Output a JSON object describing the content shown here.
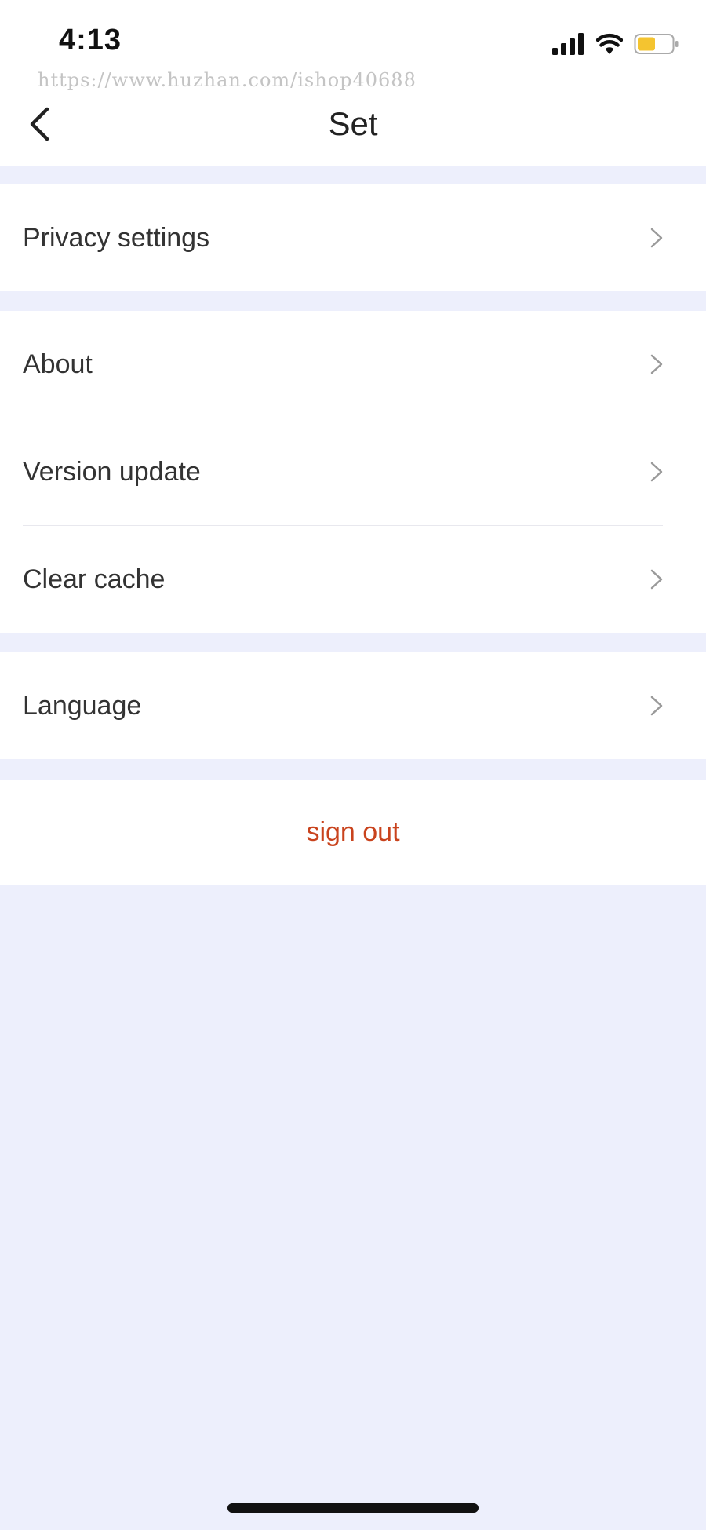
{
  "status_bar": {
    "time": "4:13",
    "battery_color": "#F4C430"
  },
  "watermark": "https://www.huzhan.com/ishop40688",
  "header": {
    "title": "Set"
  },
  "groups": [
    {
      "items": [
        {
          "label": "Privacy settings"
        }
      ]
    },
    {
      "items": [
        {
          "label": "About"
        },
        {
          "label": "Version update"
        },
        {
          "label": "Clear cache"
        }
      ]
    },
    {
      "items": [
        {
          "label": "Language"
        }
      ]
    }
  ],
  "sign_out": {
    "label": "sign out",
    "color": "#C9431D"
  },
  "colors": {
    "background": "#EDEFFC",
    "card": "#FFFFFF"
  }
}
